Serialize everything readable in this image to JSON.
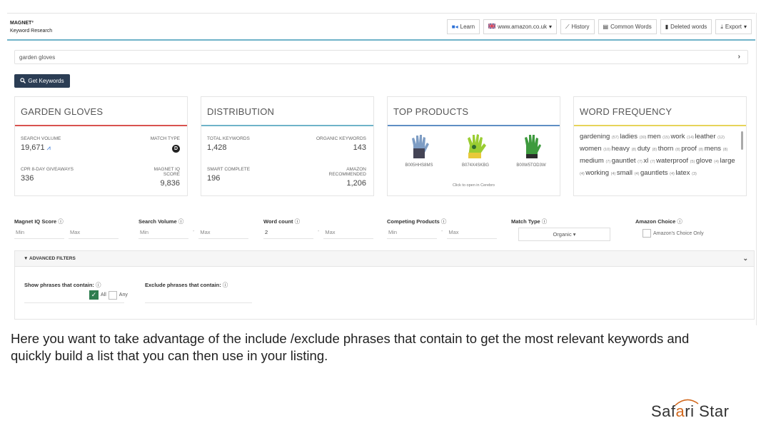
{
  "app": {
    "brand_line1": "MAGNET³",
    "brand_line2": "Keyword Research"
  },
  "toolbar": {
    "learn": "Learn",
    "marketplace": "www.amazon.co.uk",
    "history": "History",
    "common_words": "Common Words",
    "deleted_words": "Deleted words",
    "export": "Export"
  },
  "search": {
    "value": "garden gloves"
  },
  "get_keywords": "Get Keywords",
  "cards": {
    "summary": {
      "title": "GARDEN GLOVES",
      "search_volume_label": "SEARCH VOLUME",
      "search_volume": "19,671",
      "match_type_label": "MATCH TYPE",
      "match_type_badge": "D",
      "cpr_label": "CPR 8-DAY GIVEAWAYS",
      "cpr": "336",
      "iq_label": "MAGNET IQ SCORE",
      "iq": "9,836"
    },
    "distribution": {
      "title": "DISTRIBUTION",
      "total_label": "TOTAL KEYWORDS",
      "total": "1,428",
      "organic_label": "ORGANIC KEYWORDS",
      "organic": "143",
      "smart_label": "SMART COMPLETE",
      "smart": "196",
      "amazon_label": "AMAZON RECOMMENDED",
      "amazon": "1,206"
    },
    "top_products": {
      "title": "TOP PRODUCTS",
      "products": [
        {
          "asin": "B005HHS8MS",
          "color": "#6b8fb8"
        },
        {
          "asin": "B074X4SKBG",
          "color": "#9acd32"
        },
        {
          "asin": "B00W5TOD3W",
          "color": "#3e9a3e"
        }
      ],
      "click_note": "Click to open in Cerebro"
    },
    "word_frequency": {
      "title": "WORD FREQUENCY",
      "words": [
        {
          "w": "gardening",
          "n": "(57)"
        },
        {
          "w": "ladies",
          "n": "(30)"
        },
        {
          "w": "men",
          "n": "(15)"
        },
        {
          "w": "work",
          "n": "(14)"
        },
        {
          "w": "leather",
          "n": "(12)"
        },
        {
          "w": "women",
          "n": "(10)"
        },
        {
          "w": "heavy",
          "n": "(8)"
        },
        {
          "w": "duty",
          "n": "(8)"
        },
        {
          "w": "thorn",
          "n": "(8)"
        },
        {
          "w": "proof",
          "n": "(8)"
        },
        {
          "w": "mens",
          "n": "(8)"
        },
        {
          "w": "medium",
          "n": "(7)"
        },
        {
          "w": "gauntlet",
          "n": "(7)"
        },
        {
          "w": "xl",
          "n": "(7)"
        },
        {
          "w": "waterproof",
          "n": "(5)"
        },
        {
          "w": "glove",
          "n": "(4)"
        },
        {
          "w": "large",
          "n": "(4)"
        },
        {
          "w": "working",
          "n": "(4)"
        },
        {
          "w": "small",
          "n": "(4)"
        },
        {
          "w": "gauntlets",
          "n": "(4)"
        },
        {
          "w": "latex",
          "n": "(3)"
        }
      ]
    }
  },
  "filters": {
    "iq": {
      "label": "Magnet IQ Score",
      "min": "Min",
      "max": "Max"
    },
    "search_volume": {
      "label": "Search Volume",
      "min": "Min",
      "max": "Max"
    },
    "word_count": {
      "label": "Word count",
      "min": "2",
      "max": "Max"
    },
    "competing": {
      "label": "Competing Products",
      "min": "Min",
      "max": "Max"
    },
    "match_type": {
      "label": "Match Type",
      "value": "Organic"
    },
    "amazon_choice": {
      "label": "Amazon Choice",
      "option": "Amazon's Choice Only"
    }
  },
  "advanced": {
    "title": "ADVANCED FILTERS",
    "show_label": "Show phrases that contain:",
    "exclude_label": "Exclude phrases that contain:",
    "all": "All",
    "any": "Any"
  },
  "caption": "Here you want to take advantage of the include /exclude phrases that contain to get the most relevant keywords and quickly build a list that you can then use in your  listing.",
  "logo": {
    "part1": "Saf",
    "part2": "a",
    "part3": "ri Star"
  }
}
